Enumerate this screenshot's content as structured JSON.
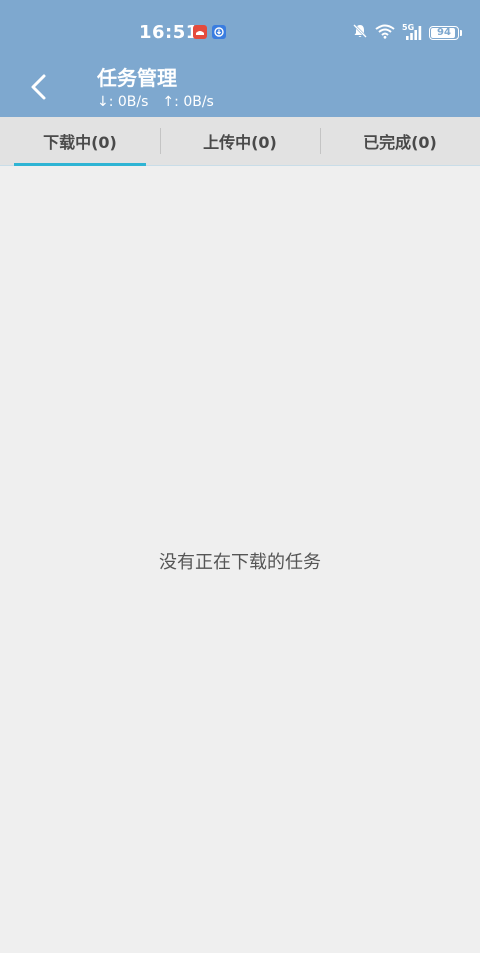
{
  "status_bar": {
    "time": "16:51",
    "network_type": "5G",
    "battery_level": "94",
    "battery_fraction": 0.94
  },
  "header": {
    "title": "任务管理",
    "download_speed": "↓: 0B/s",
    "upload_speed": "↑: 0B/s"
  },
  "tabs": [
    {
      "label": "下载中(0)",
      "active": true
    },
    {
      "label": "上传中(0)",
      "active": false
    },
    {
      "label": "已完成(0)",
      "active": false
    }
  ],
  "main": {
    "empty_message": "没有正在下载的任务"
  },
  "colors": {
    "header_bg": "#7ea8cf",
    "tab_bar_bg": "#e2e2e2",
    "tab_indicator": "#2eb4d4",
    "content_bg": "#efefef"
  },
  "icons": {
    "back": "chevron-left-icon",
    "notification_1": "app-notification-icon",
    "notification_2": "download-notification-icon",
    "mute": "bell-off-icon",
    "wifi": "wifi-icon",
    "signal": "signal-icon",
    "battery": "battery-icon"
  }
}
